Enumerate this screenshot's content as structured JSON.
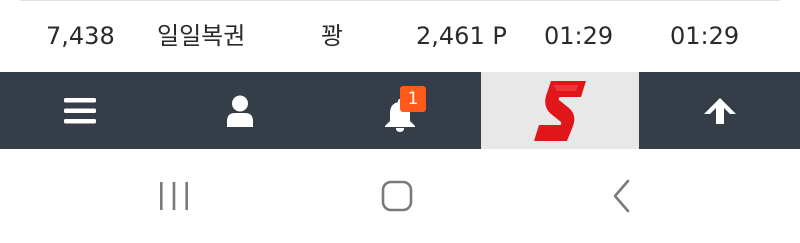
{
  "row": {
    "number": "7,438",
    "name": "일일복권",
    "result": "꽝",
    "points": "2,461 P",
    "time_start": "01:29",
    "time_end": "01:29"
  },
  "nav": {
    "items": [
      {
        "name": "menu",
        "icon": "hamburger-menu-icon"
      },
      {
        "name": "profile",
        "icon": "user-icon"
      },
      {
        "name": "notifications",
        "icon": "bell-icon",
        "badge": "1"
      },
      {
        "name": "logo",
        "icon": "red-s-logo",
        "letter": "S"
      },
      {
        "name": "scroll-top",
        "icon": "arrow-up-icon"
      }
    ]
  },
  "system_nav": {
    "items": [
      "recent-apps-icon",
      "home-icon",
      "back-icon"
    ]
  },
  "colors": {
    "nav_background": "#343d48",
    "badge": "#ff5a1a",
    "logo_background": "#e8e8e8",
    "logo_red": "#e0161b"
  }
}
